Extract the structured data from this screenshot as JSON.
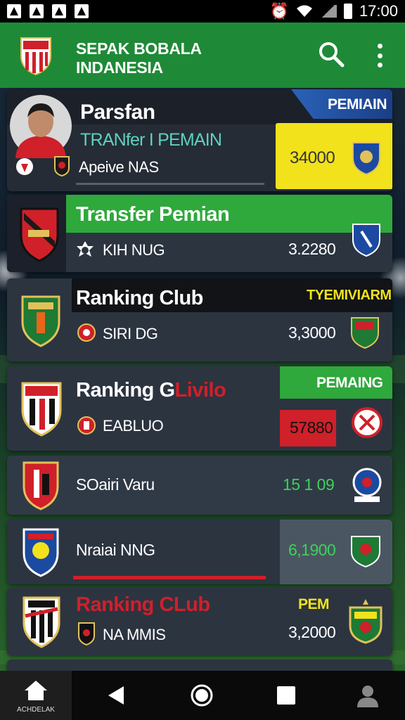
{
  "status_bar": {
    "time": "17:00"
  },
  "app_bar": {
    "title_line1": "SEPAK BOBALA",
    "title_line2": "INDANESIA"
  },
  "cards": [
    {
      "title": "Parsfan",
      "subtitle": "TRANfer I PEMAIN",
      "meta": "Apeive NAS",
      "tag": "PEMIAIN",
      "value": "34000"
    },
    {
      "title": "Transfer Pemian",
      "meta": "KIH NUG",
      "value": "3.2280"
    },
    {
      "title": "Ranking Club",
      "tag": "TYEMIVIARM",
      "meta": "SIRI DG",
      "value": "3,3000"
    },
    {
      "title_a": "Ranking G",
      "title_b": "Livilo",
      "tag": "PEMAING",
      "meta": "EABLUO",
      "value": "57880"
    },
    {
      "title": "SOairi Varu",
      "value": "15 1 09"
    },
    {
      "title": "Nraiai NNG",
      "value": "6,1900"
    },
    {
      "title": "Ranking CLub",
      "tag": "PEM",
      "meta": "NA  MMIS",
      "value": "3,2000"
    }
  ],
  "nav_bar": {
    "home_label": "ACHDELAK"
  },
  "colors": {
    "app_green": "#1e8a37",
    "card_bg": "#2c3440",
    "yellow": "#f1e21c",
    "red": "#d0202a",
    "teal": "#5fd1c0"
  }
}
